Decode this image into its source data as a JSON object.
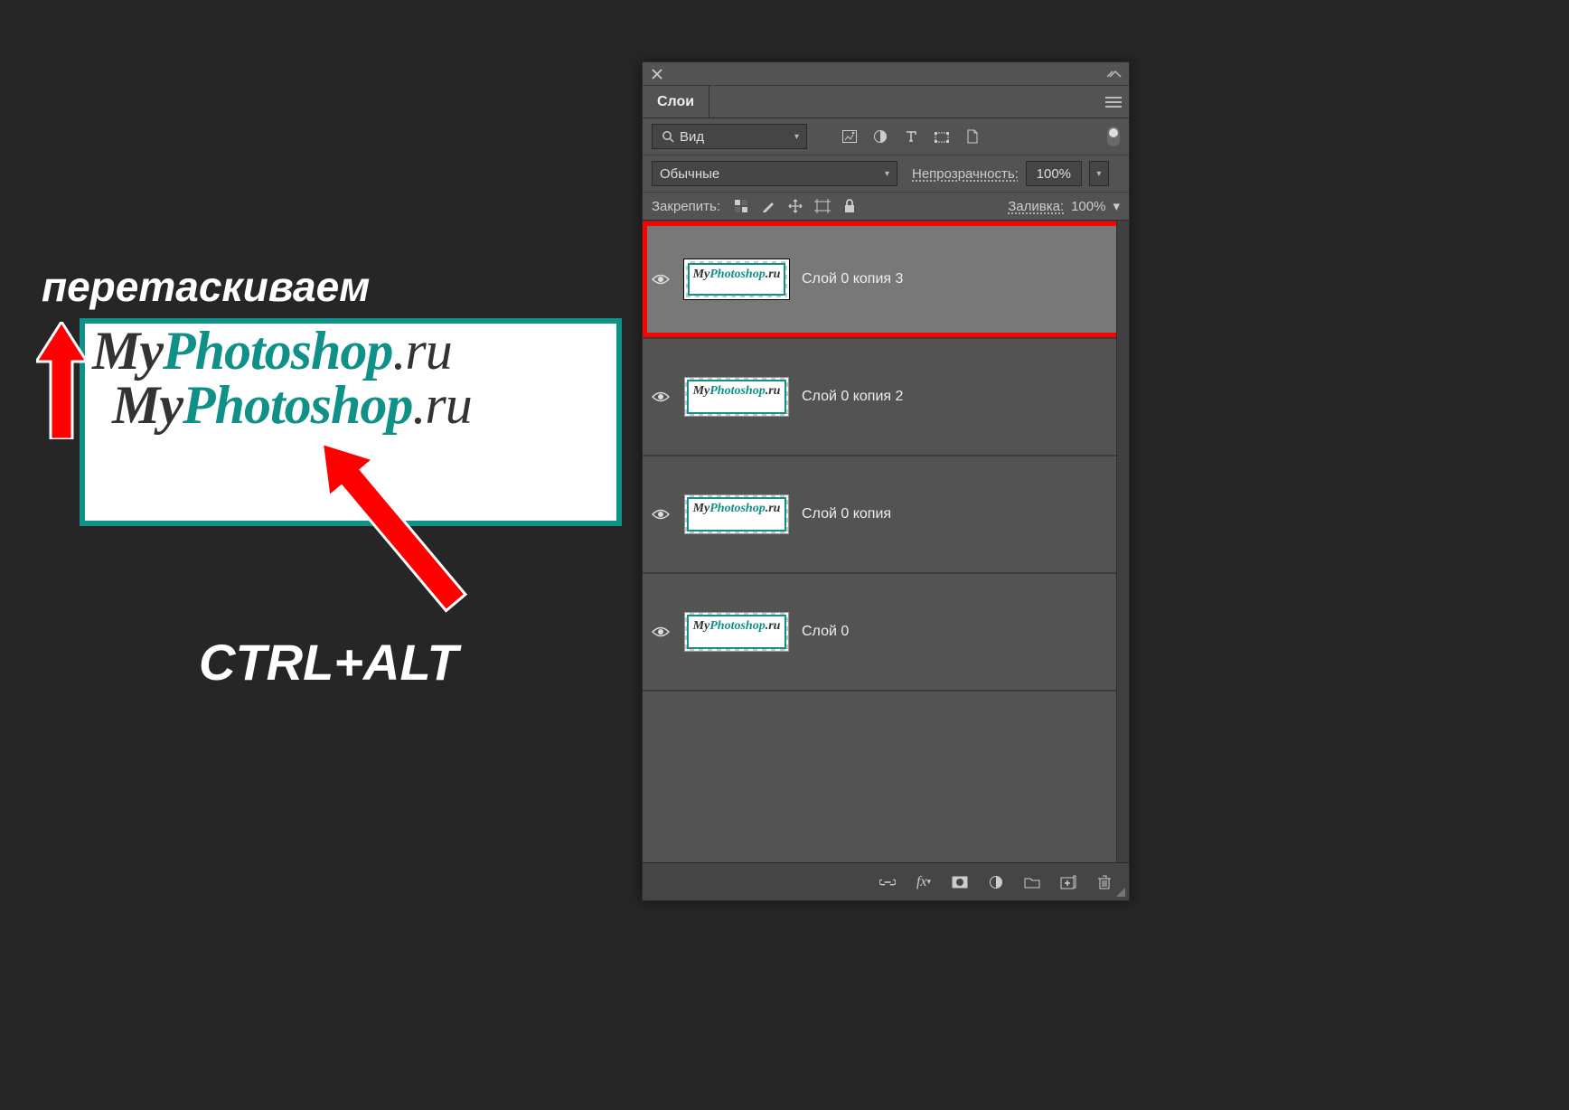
{
  "annotations": {
    "drag_label": "перетаскиваем",
    "shortcut_label": "CTRL+ALT"
  },
  "canvas": {
    "logo_my": "My",
    "logo_ps": "Photoshop",
    "logo_ru": ".ru"
  },
  "panel": {
    "tab_label": "Слои",
    "search_label": "Вид",
    "blend_mode": "Обычные",
    "opacity_label": "Непрозрачность:",
    "opacity_value": "100%",
    "lock_label": "Закрепить:",
    "fill_label": "Заливка:",
    "fill_value": "100%",
    "layers": [
      {
        "name": "Слой 0 копия 3",
        "selected": true
      },
      {
        "name": "Слой 0 копия 2",
        "selected": false
      },
      {
        "name": "Слой 0 копия",
        "selected": false
      },
      {
        "name": "Слой 0",
        "selected": false
      }
    ]
  },
  "thumb_logo": {
    "my": "My",
    "ps": "Photoshop",
    "ru": ".ru"
  }
}
